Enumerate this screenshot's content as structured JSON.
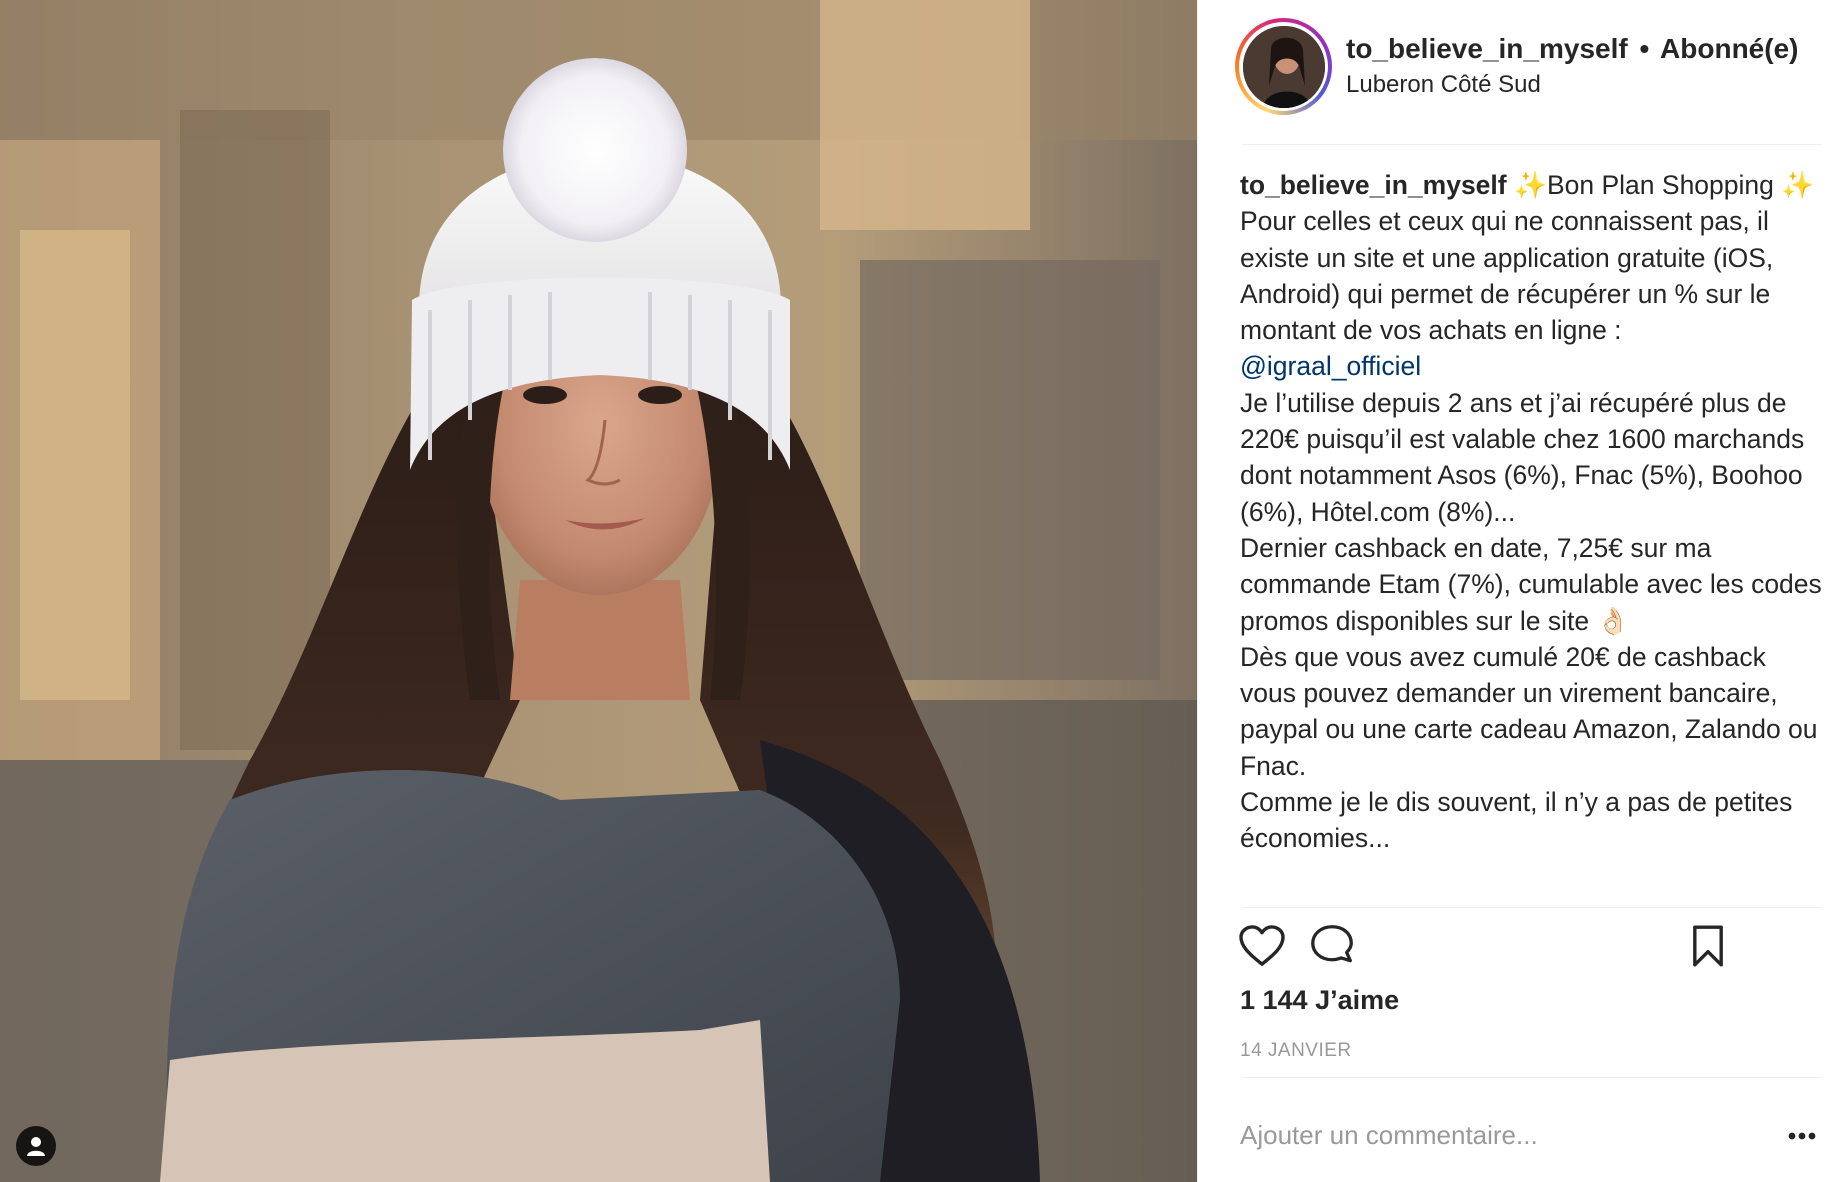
{
  "post": {
    "header": {
      "username": "to_believe_in_myself",
      "separator": "•",
      "follow_status": "Abonné(e)",
      "location": "Luberon Côté Sud"
    },
    "caption": {
      "username": "to_believe_in_myself",
      "line_sparkle": "✨Bon Plan Shopping ✨",
      "text_before_mention": "Pour celles et ceux qui ne connaissent pas, il existe un site et une application gratuite (iOS, Android) qui permet de récupérer un % sur le montant de vos achats en ligne :",
      "mention": "@igraal_officiel",
      "text_after_mention": "Je l’utilise depuis 2 ans et j’ai récupéré plus de 220€ puisqu’il est valable chez 1600 marchands dont notamment Asos (6%), Fnac (5%), Boohoo (6%), Hôtel.com (8%)...\nDernier cashback en date, 7,25€ sur ma commande Etam (7%), cumulable avec les codes promos disponibles sur le site 👌🏻\nDès que vous avez cumulé 20€ de cashback vous pouvez demander un virement bancaire, paypal ou une carte cadeau Amazon, Zalando ou Fnac.\nComme je le dis souvent, il n’y a pas de petites économies..."
    },
    "icons": {
      "like": "heart-outline-icon",
      "comment": "speech-bubble-icon",
      "save": "bookmark-icon",
      "more": "ellipsis-icon",
      "tag": "person-tag-icon"
    },
    "likes_label": "1 144 J’aime",
    "date_label": "14 JANVIER",
    "comment_placeholder": "Ajouter un commentaire...",
    "more_label": "•••"
  },
  "colors": {
    "text": "#262626",
    "muted": "#999999",
    "mention": "#003569",
    "divider": "#efefef"
  }
}
